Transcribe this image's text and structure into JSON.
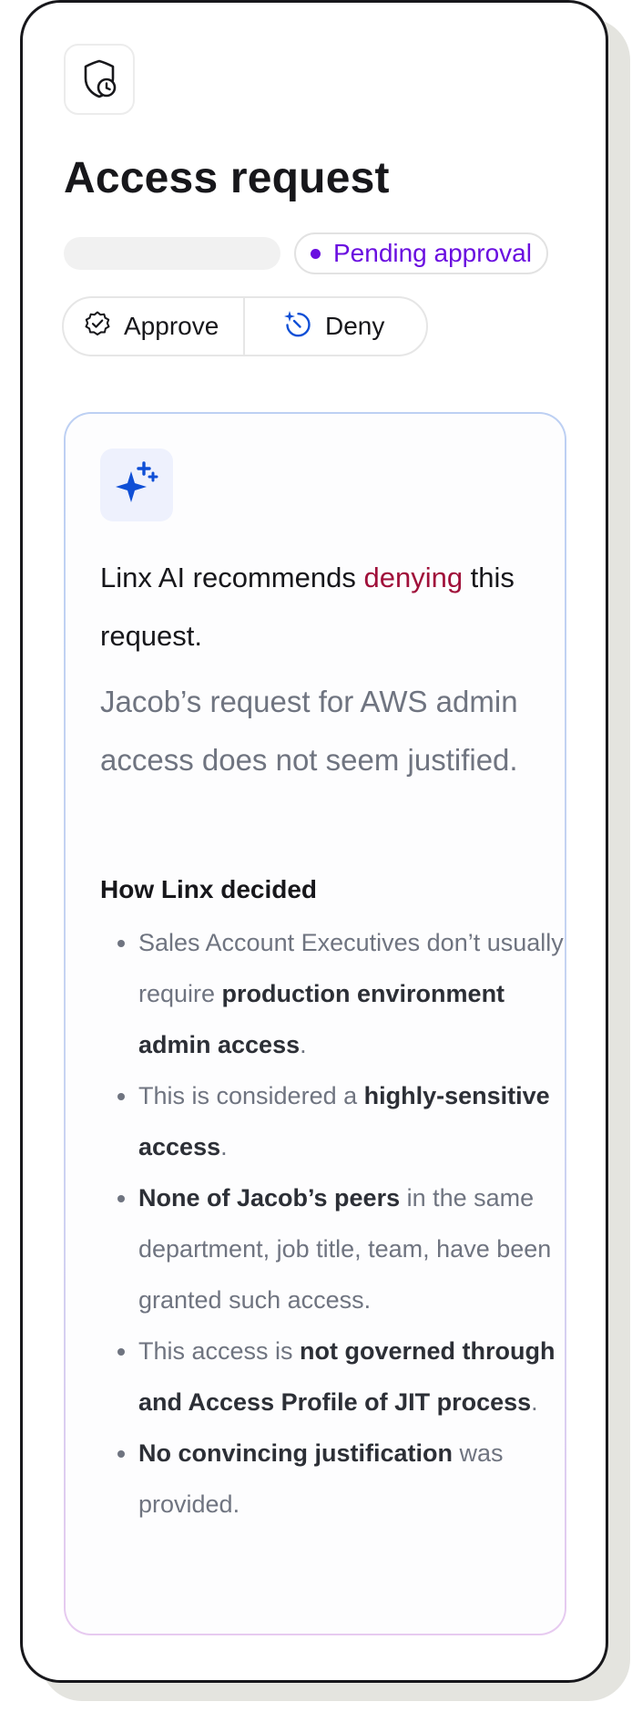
{
  "header": {
    "title": "Access request",
    "status": "Pending approval",
    "icon": "shield-clock-icon"
  },
  "actions": {
    "approve_label": "Approve",
    "deny_label": "Deny"
  },
  "ai": {
    "icon": "sparkles-icon",
    "recommend_prefix": "Linx AI recommends ",
    "recommend_verdict": "denying",
    "recommend_suffix": " this request.",
    "summary": "Jacob’s request for AWS admin access does not seem justified.",
    "how_heading": "How Linx decided",
    "reasons": [
      [
        {
          "t": "Sales Account Executives don’t usually require ",
          "b": false
        },
        {
          "t": "production environment admin access",
          "b": true
        },
        {
          "t": ".",
          "b": false
        }
      ],
      [
        {
          "t": "This is considered a ",
          "b": false
        },
        {
          "t": "highly-sensitive access",
          "b": true
        },
        {
          "t": ".",
          "b": false
        }
      ],
      [
        {
          "t": "None of Jacob’s peers",
          "b": true
        },
        {
          "t": " in the same department, job title, team, have been granted such access.",
          "b": false
        }
      ],
      [
        {
          "t": "This access is ",
          "b": false
        },
        {
          "t": "not governed through and Access Profile of JIT process",
          "b": true
        },
        {
          "t": ".",
          "b": false
        }
      ],
      [
        {
          "t": "No convincing justification",
          "b": true
        },
        {
          "t": " was provided.",
          "b": false
        }
      ]
    ]
  },
  "colors": {
    "pending": "#6a0ee0",
    "deny": "#a0103a",
    "accent": "#0f4fd6"
  }
}
